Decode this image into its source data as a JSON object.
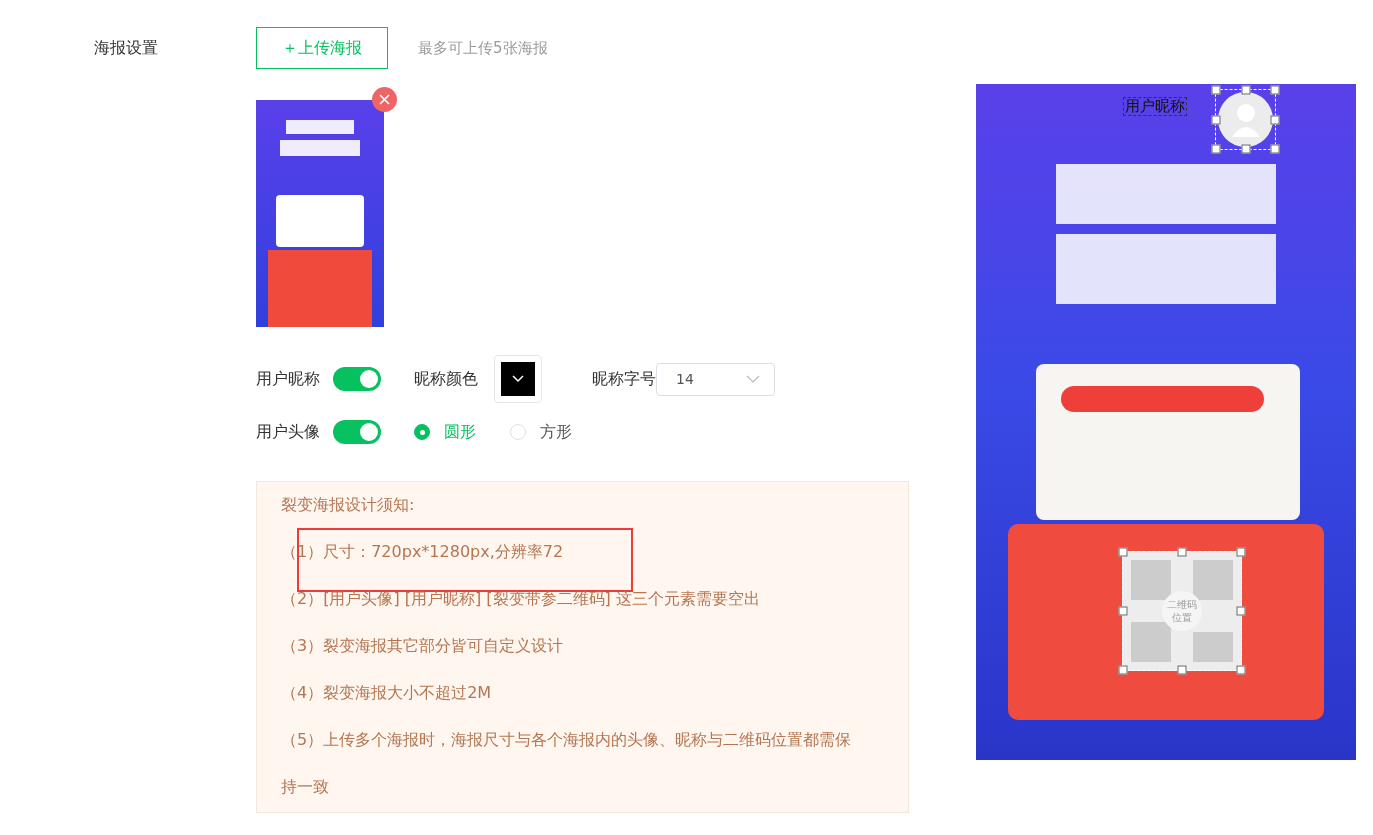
{
  "section_label": "海报设置",
  "upload": {
    "button": "＋上传海报",
    "hint": "最多可上传5张海报"
  },
  "nickname": {
    "label": "用户昵称",
    "on": true,
    "color_label": "昵称颜色",
    "color": "#000000",
    "size_label": "昵称字号",
    "size": "14"
  },
  "avatar": {
    "label": "用户头像",
    "on": true,
    "shapes": [
      {
        "label": "圆形",
        "selected": true
      },
      {
        "label": "方形",
        "selected": false
      }
    ]
  },
  "notice": {
    "title": "裂变海报设计须知:",
    "items": [
      {
        "text": "（1）尺寸：720px*1280px,分辨率72",
        "highlighted": true
      },
      {
        "text": "（2）[用户头像] [用户昵称] [裂变带参二维码] 这三个元素需要空出",
        "highlighted": false
      },
      {
        "text": "（3）裂变海报其它部分皆可自定义设计",
        "highlighted": false
      },
      {
        "text": "（4）裂变海报大小不超过2M",
        "highlighted": false
      },
      {
        "text": "（5）上传多个海报时，海报尺寸与各个海报内的头像、昵称与二维码位置都需保持一致",
        "highlighted": false
      }
    ]
  },
  "preview": {
    "nickname": "用户昵称",
    "qr_label": "二维码位置"
  }
}
